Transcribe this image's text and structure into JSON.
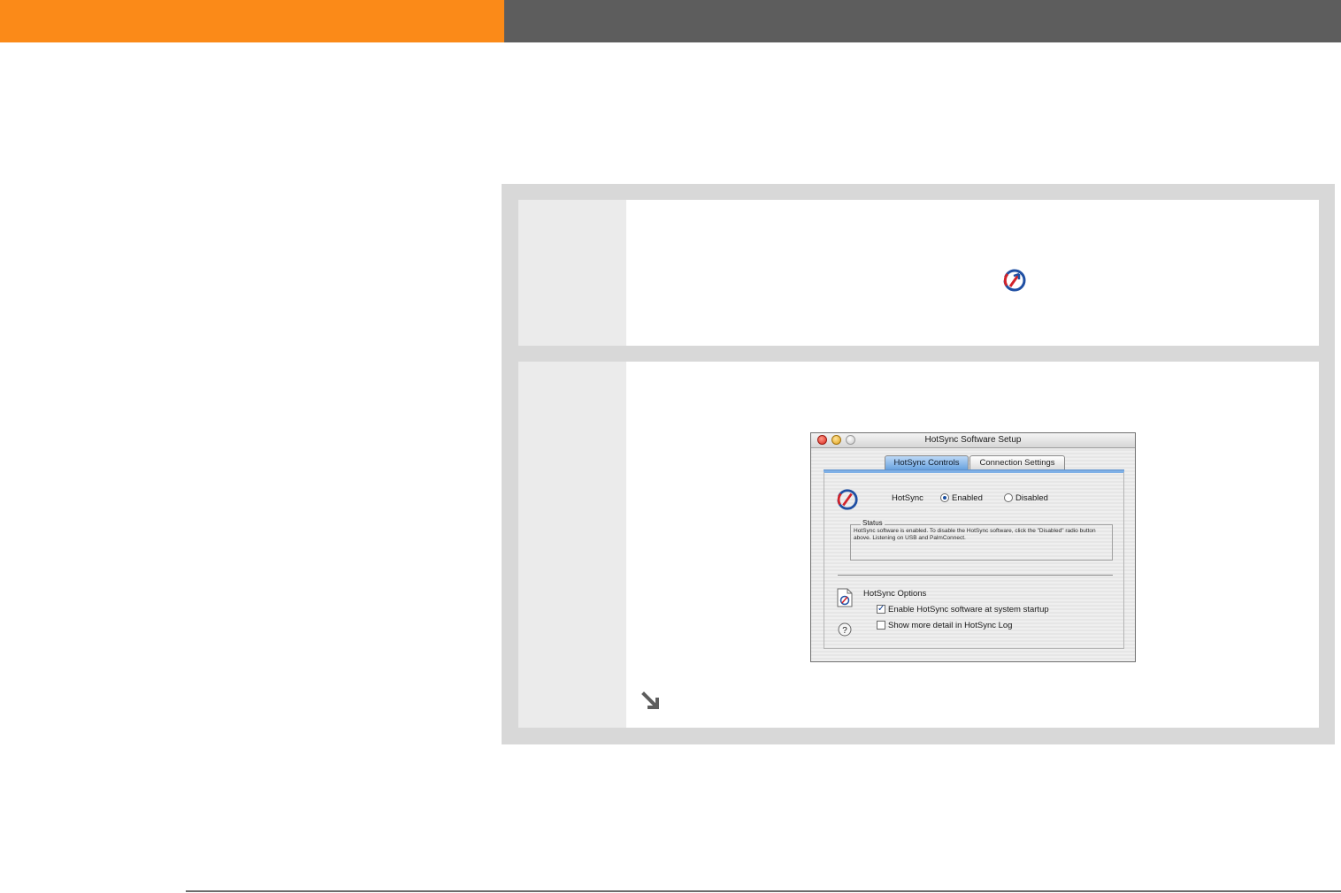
{
  "colors": {
    "header_orange": "#fb8a18",
    "header_gray": "#5d5d5d",
    "frame_gray": "#d8d8d8",
    "step_num_gray": "#ebebeb",
    "hotsync_red": "#d2232a",
    "hotsync_blue": "#1f4fa3"
  },
  "icons": {
    "inline": "hotsync-icon",
    "continue": "continue-arrow-icon",
    "window_app": "hotsync-icon",
    "options": "hotsync-document-icon",
    "help": "question-mark-icon"
  },
  "window": {
    "title": "HotSync Software Setup",
    "tabs": [
      {
        "label": "HotSync Controls",
        "active": true
      },
      {
        "label": "Connection Settings",
        "active": false
      }
    ],
    "hotsync_label": "HotSync",
    "radio_enabled": "Enabled",
    "radio_disabled": "Disabled",
    "status_label": "Status",
    "status_text": "HotSync software is enabled. To disable the HotSync software, click the \"Disabled\" radio button above. Listening on USB and PalmConnect.",
    "options_label": "HotSync Options",
    "checkbox_startup": "Enable HotSync software at system startup",
    "checkbox_detail": "Show more detail in HotSync Log",
    "startup_checked": true,
    "detail_checked": false
  }
}
